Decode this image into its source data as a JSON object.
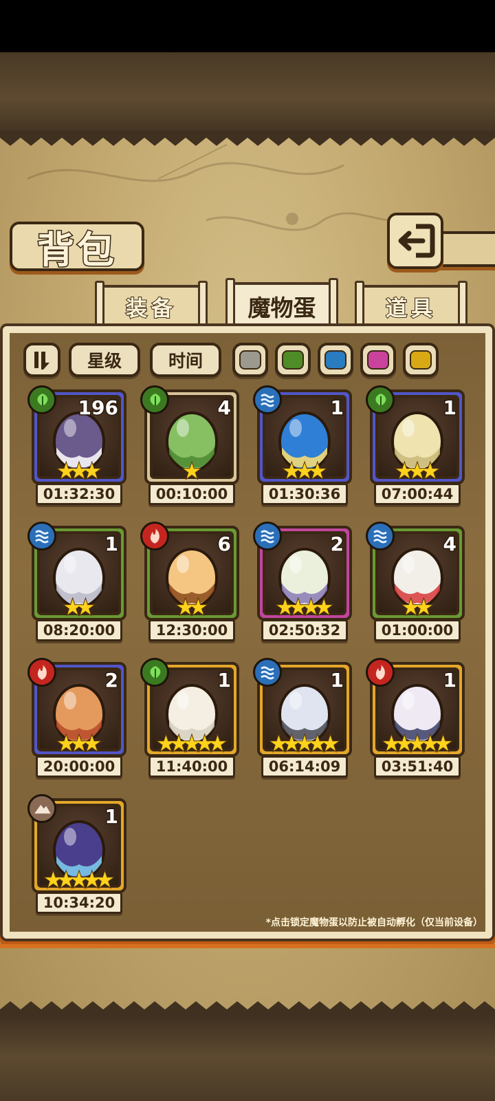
{
  "header": {
    "title": "背包"
  },
  "tabs": [
    {
      "label": "装备",
      "active": false
    },
    {
      "label": "魔物蛋",
      "active": true
    },
    {
      "label": "道具",
      "active": false
    }
  ],
  "filters": {
    "sort_labels": [
      "星级",
      "时间"
    ],
    "color_swatches": [
      "#9c9a8e",
      "#4d8c27",
      "#2a7cc0",
      "#c9439d",
      "#d9a915"
    ]
  },
  "eggs": [
    {
      "count": "196",
      "stars": "★★★",
      "timer": "01:32:30",
      "element": "grass",
      "frame": "#5256c8",
      "body": "#6b5a8c",
      "accent": "#ffffff"
    },
    {
      "count": "4",
      "stars": "★",
      "timer": "00:10:00",
      "element": "grass",
      "frame": "#d8c59a",
      "body": "#86c063",
      "accent": "#4e8a33"
    },
    {
      "count": "1",
      "stars": "★★★",
      "timer": "01:30:36",
      "element": "water",
      "frame": "#5256c8",
      "body": "#2f7fd6",
      "accent": "#ffe070"
    },
    {
      "count": "1",
      "stars": "★★★",
      "timer": "07:00:44",
      "element": "grass",
      "frame": "#5256c8",
      "body": "#efe3b0",
      "accent": "#c9b878"
    },
    {
      "count": "1",
      "stars": "★★",
      "timer": "08:20:00",
      "element": "water",
      "frame": "#6a9a35",
      "body": "#e8e8ee",
      "accent": "#b8b8c8"
    },
    {
      "count": "6",
      "stars": "★★",
      "timer": "12:30:00",
      "element": "fire",
      "frame": "#6a9a35",
      "body": "#f5c682",
      "accent": "#8a4a1c"
    },
    {
      "count": "2",
      "stars": "★★★★",
      "timer": "02:50:32",
      "element": "water",
      "frame": "#c246a0",
      "body": "#eaf0dc",
      "accent": "#8a7ab8"
    },
    {
      "count": "4",
      "stars": "★★",
      "timer": "01:00:00",
      "element": "water",
      "frame": "#6a9a35",
      "body": "#f2efe8",
      "accent": "#d83a3a"
    },
    {
      "count": "2",
      "stars": "★★★",
      "timer": "20:00:00",
      "element": "fire",
      "frame": "#5256c8",
      "body": "#e49a5c",
      "accent": "#b84a2a"
    },
    {
      "count": "1",
      "stars": "★★★★★",
      "timer": "11:40:00",
      "element": "grass",
      "frame": "#e3a72a",
      "body": "#f4efe2",
      "accent": "#d6d0c0"
    },
    {
      "count": "1",
      "stars": "★★★★★",
      "timer": "06:14:09",
      "element": "water",
      "frame": "#e3a72a",
      "body": "#dfe4f0",
      "accent": "#4b4b55"
    },
    {
      "count": "1",
      "stars": "★★★★★",
      "timer": "03:51:40",
      "element": "fire",
      "frame": "#e3a72a",
      "body": "#efe9f4",
      "accent": "#3b3f66"
    },
    {
      "count": "1",
      "stars": "★★★★★",
      "timer": "10:34:20",
      "element": "earth",
      "frame": "#e3a72a",
      "body": "#4a3f8c",
      "accent": "#7fd0f0"
    }
  ],
  "element_colors": {
    "grass": "#3b7a21",
    "water": "#2b6fb8",
    "fire": "#c4261f",
    "earth": "#8a6a55"
  },
  "footnote": "*点击锁定魔物蛋以防止被自动孵化（仅当前设备）"
}
